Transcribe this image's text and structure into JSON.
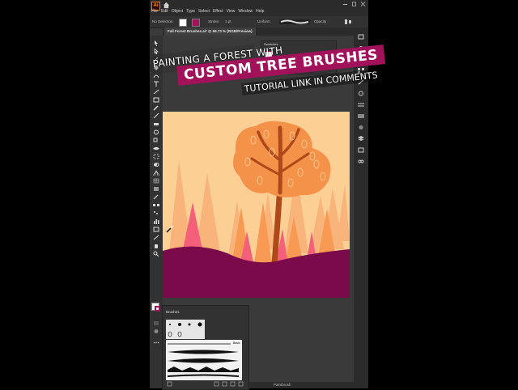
{
  "app": {
    "logo": "Ai",
    "menu": [
      "File",
      "Edit",
      "Object",
      "Type",
      "Select",
      "Effect",
      "View",
      "Window",
      "Help"
    ]
  },
  "control_bar": {
    "selection": "No Selection",
    "stroke_label": "Stroke:",
    "stroke_value": "1 pt",
    "profile": "Uniform",
    "opacity_label": "Opacity"
  },
  "document": {
    "tab_title": "Fall Forest Brushes.ai* @ 56.73 % (RGB/Preview)"
  },
  "panels": {
    "swatches_title": "Swatches",
    "brushes_title": "Brushes",
    "brush_stroke_label": "Basic"
  },
  "status": {
    "tool": "Paintbrush"
  },
  "overlay": {
    "line1": "Painting a forest with",
    "line2": "Custom Tree Brushes",
    "line3": "Tutorial link in comments"
  },
  "colors": {
    "accent_magenta": "#a1125a",
    "artboard_bg": "#fccf95",
    "ground": "#7b0a4a",
    "tree_light": "#f8b47a",
    "tree_pink": "#f4607a",
    "trunk": "#b0491a",
    "canopy": "#f4924a"
  }
}
